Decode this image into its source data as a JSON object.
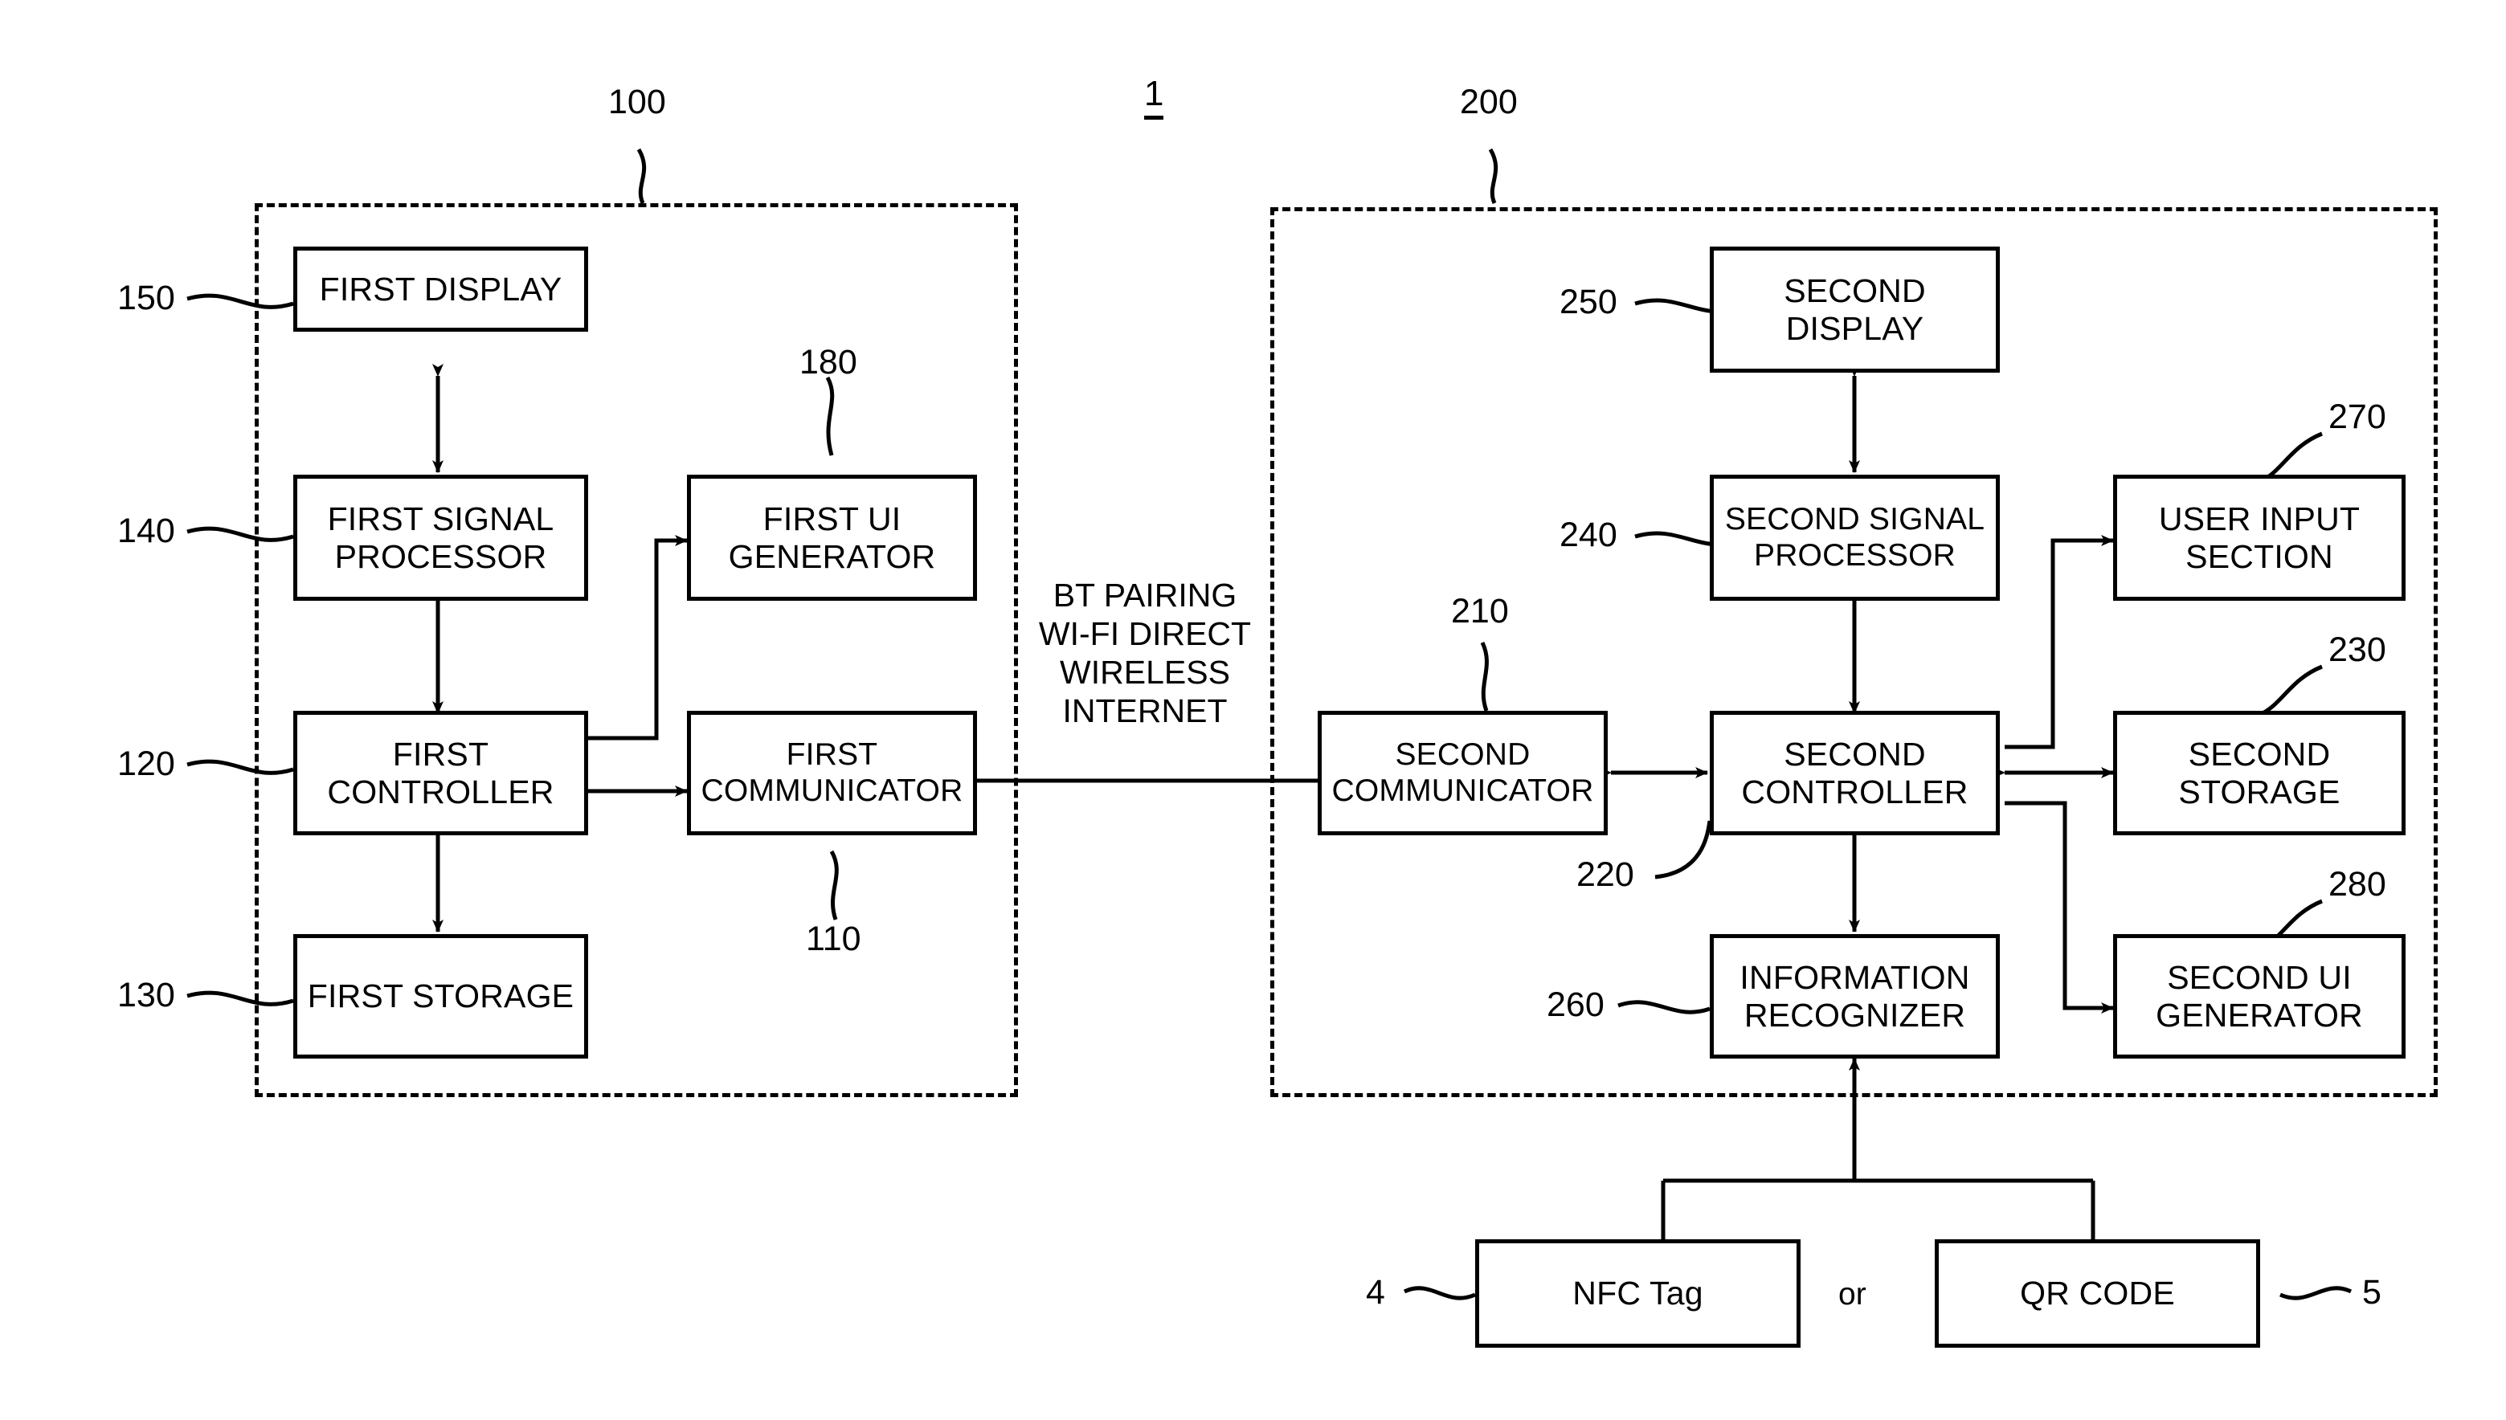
{
  "figure": {
    "number": "1",
    "device_left_ref": "100",
    "device_right_ref": "200"
  },
  "left_device": {
    "ref": "100",
    "blocks": [
      {
        "ref": "150",
        "label": "FIRST DISPLAY"
      },
      {
        "ref": "140",
        "label": "FIRST SIGNAL\nPROCESSOR"
      },
      {
        "ref": "120",
        "label": "FIRST\nCONTROLLER"
      },
      {
        "ref": "130",
        "label": "FIRST STORAGE"
      },
      {
        "ref": "180",
        "label": "FIRST UI\nGENERATOR"
      },
      {
        "ref": "110",
        "label": "FIRST\nCOMMUNICATOR"
      }
    ]
  },
  "right_device": {
    "ref": "200",
    "blocks": [
      {
        "ref": "250",
        "label": "SECOND\nDISPLAY"
      },
      {
        "ref": "240",
        "label": "SECOND SIGNAL\nPROCESSOR"
      },
      {
        "ref": "220",
        "label": "SECOND\nCONTROLLER"
      },
      {
        "ref": "210",
        "label": "SECOND\nCOMMUNICATOR"
      },
      {
        "ref": "260",
        "label": "INFORMATION\nRECOGNIZER"
      },
      {
        "ref": "270",
        "label": "USER INPUT\nSECTION"
      },
      {
        "ref": "230",
        "label": "SECOND\nSTORAGE"
      },
      {
        "ref": "280",
        "label": "SECOND UI\nGENERATOR"
      }
    ]
  },
  "link": {
    "caption": "BT PAIRING\nWI-FI DIRECT\nWIRELESS\nINTERNET"
  },
  "sources": {
    "or_label": "or",
    "items": [
      {
        "ref": "4",
        "label": "NFC Tag"
      },
      {
        "ref": "5",
        "label": "QR CODE"
      }
    ]
  },
  "colors": {
    "ink": "#000000",
    "paper": "#ffffff"
  }
}
